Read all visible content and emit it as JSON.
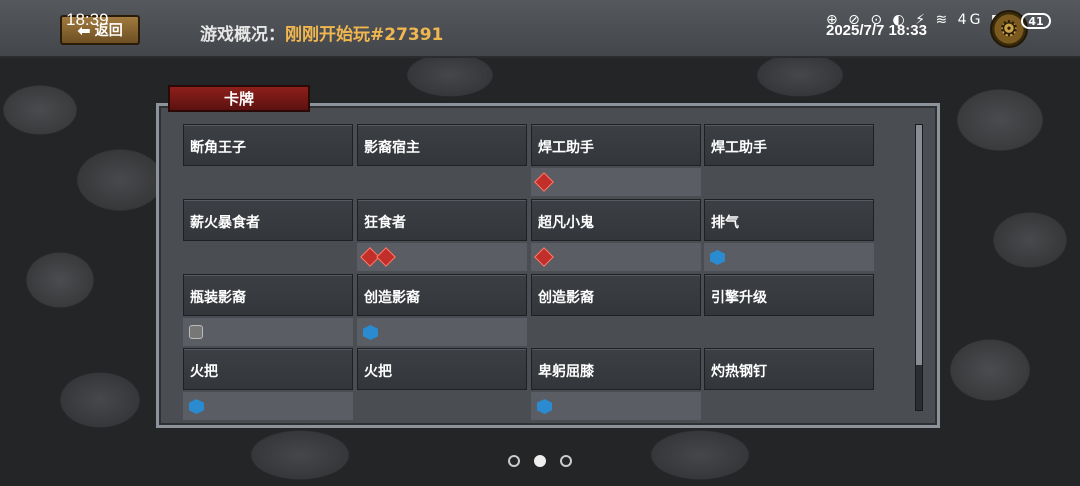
{
  "status_bar": {
    "time": "18:39",
    "datetime": "2025/7/7 18:33",
    "battery": "41",
    "icons": "⊕ ⊘ ⊙ ◐ ⚡ ≋ 4G ▮"
  },
  "header": {
    "back_label": "返回",
    "overview_label": "游戏概况：",
    "overview_value": "刚刚开始玩#27391"
  },
  "panel": {
    "tab_label": "卡牌",
    "cards": [
      {
        "name": "断角王子",
        "icons": []
      },
      {
        "name": "影裔宿主",
        "icons": []
      },
      {
        "name": "焊工助手",
        "icons": [
          "red-diamond-icon"
        ]
      },
      {
        "name": "焊工助手",
        "icons": []
      },
      {
        "name": "薪火暴食者",
        "icons": []
      },
      {
        "name": "狂食者",
        "icons": [
          "red-diamond-icon",
          "red-diamond-icon"
        ]
      },
      {
        "name": "超凡小鬼",
        "icons": [
          "red-diamond-icon"
        ]
      },
      {
        "name": "排气",
        "icons": [
          "blue-hex-icon"
        ]
      },
      {
        "name": "瓶装影裔",
        "icons": [
          "grey-gem-icon"
        ]
      },
      {
        "name": "创造影裔",
        "icons": [
          "blue-hex-icon"
        ]
      },
      {
        "name": "创造影裔",
        "icons": []
      },
      {
        "name": "引擎升级",
        "icons": []
      },
      {
        "name": "火把",
        "icons": [
          "blue-hex-icon"
        ]
      },
      {
        "name": "火把",
        "icons": []
      },
      {
        "name": "卑躬屈膝",
        "icons": [
          "blue-hex-icon"
        ]
      },
      {
        "name": "灼热钢钉",
        "icons": []
      }
    ]
  },
  "pagination": {
    "pages": 3,
    "active": 2
  }
}
